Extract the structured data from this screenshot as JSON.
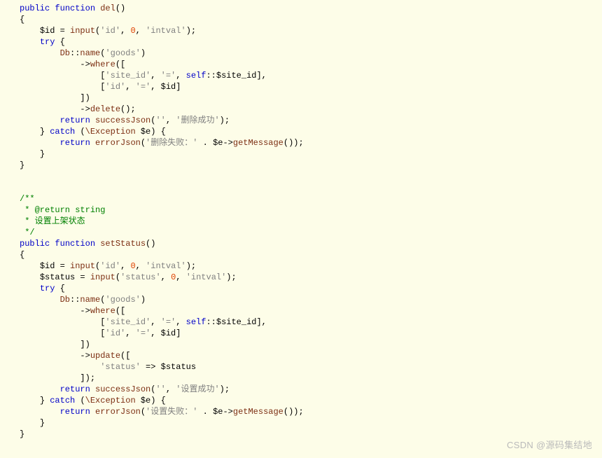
{
  "code": {
    "l01_public": "public",
    "l01_function": "function",
    "l01_name": "del",
    "l01_paren": "()",
    "l02": "{",
    "l03_var": "$id",
    "l03_eq": " = ",
    "l03_input": "input",
    "l03_open": "(",
    "l03_s1": "'id'",
    "l03_c": ", ",
    "l03_n": "0",
    "l03_c2": ", ",
    "l03_s2": "'intval'",
    "l03_close": ");",
    "l04_try": "try",
    "l04_brace": " {",
    "l05_db": "Db",
    "l05_colon": "::",
    "l05_name": "name",
    "l05_open": "(",
    "l05_s": "'goods'",
    "l05_close": ")",
    "l06_arrow": "->",
    "l06_where": "where",
    "l06_open": "([",
    "l07_open": "[",
    "l07_s1": "'site_id'",
    "l07_c": ", ",
    "l07_s2": "'='",
    "l07_c2": ", ",
    "l07_self": "self",
    "l07_colon": "::",
    "l07_var": "$site_id",
    "l07_close": "],",
    "l08_open": "[",
    "l08_s1": "'id'",
    "l08_c": ", ",
    "l08_s2": "'='",
    "l08_c2": ", ",
    "l08_var": "$id",
    "l08_close": "]",
    "l09": "])",
    "l10_arrow": "->",
    "l10_del": "delete",
    "l10_close": "();",
    "l11_return": "return",
    "l11_fn": "successJson",
    "l11_open": "(",
    "l11_s1": "''",
    "l11_c": ", ",
    "l11_s2": "'删除成功'",
    "l11_close": ");",
    "l12_close": "}",
    "l12_catch": " catch ",
    "l12_open": "(",
    "l12_exc": "\\Exception",
    "l12_sp": " ",
    "l12_var": "$e",
    "l12_close2": ") {",
    "l13_return": "return",
    "l13_fn": "errorJson",
    "l13_open": "(",
    "l13_s1": "'删除失败：'",
    "l13_cat": " . ",
    "l13_var": "$e",
    "l13_arrow": "->",
    "l13_gm": "getMessage",
    "l13_close": "());",
    "l14": "}",
    "l15": "}",
    "c1": "/**",
    "c2": " * @return string",
    "c3": " * 设置上架状态",
    "c4": " */",
    "l20_public": "public",
    "l20_function": "function",
    "l20_name": "setStatus",
    "l20_paren": "()",
    "l21": "{",
    "l22_var": "$id",
    "l22_eq": " = ",
    "l22_input": "input",
    "l22_open": "(",
    "l22_s1": "'id'",
    "l22_c": ", ",
    "l22_n": "0",
    "l22_c2": ", ",
    "l22_s2": "'intval'",
    "l22_close": ");",
    "l23_var": "$status",
    "l23_eq": " = ",
    "l23_input": "input",
    "l23_open": "(",
    "l23_s1": "'status'",
    "l23_c": ", ",
    "l23_n": "0",
    "l23_c2": ", ",
    "l23_s2": "'intval'",
    "l23_close": ");",
    "l24_try": "try",
    "l24_brace": " {",
    "l25_db": "Db",
    "l25_colon": "::",
    "l25_name": "name",
    "l25_open": "(",
    "l25_s": "'goods'",
    "l25_close": ")",
    "l26_arrow": "->",
    "l26_where": "where",
    "l26_open": "([",
    "l27_open": "[",
    "l27_s1": "'site_id'",
    "l27_c": ", ",
    "l27_s2": "'='",
    "l27_c2": ", ",
    "l27_self": "self",
    "l27_colon": "::",
    "l27_var": "$site_id",
    "l27_close": "],",
    "l28_open": "[",
    "l28_s1": "'id'",
    "l28_c": ", ",
    "l28_s2": "'='",
    "l28_c2": ", ",
    "l28_var": "$id",
    "l28_close": "]",
    "l29": "])",
    "l30_arrow": "->",
    "l30_upd": "update",
    "l30_open": "([",
    "l31_s1": "'status'",
    "l31_arrow": " => ",
    "l31_var": "$status",
    "l32": "]);",
    "l33_return": "return",
    "l33_fn": "successJson",
    "l33_open": "(",
    "l33_s1": "''",
    "l33_c": ", ",
    "l33_s2": "'设置成功'",
    "l33_close": ");",
    "l34_close": "}",
    "l34_catch": " catch ",
    "l34_open": "(",
    "l34_exc": "\\Exception",
    "l34_sp": " ",
    "l34_var": "$e",
    "l34_close2": ") {",
    "l35_return": "return",
    "l35_fn": "errorJson",
    "l35_open": "(",
    "l35_s1": "'设置失败：'",
    "l35_cat": " . ",
    "l35_var": "$e",
    "l35_arrow": "->",
    "l35_gm": "getMessage",
    "l35_close": "());",
    "l36": "}",
    "l37": "}"
  },
  "watermark": "CSDN @源码集结地"
}
